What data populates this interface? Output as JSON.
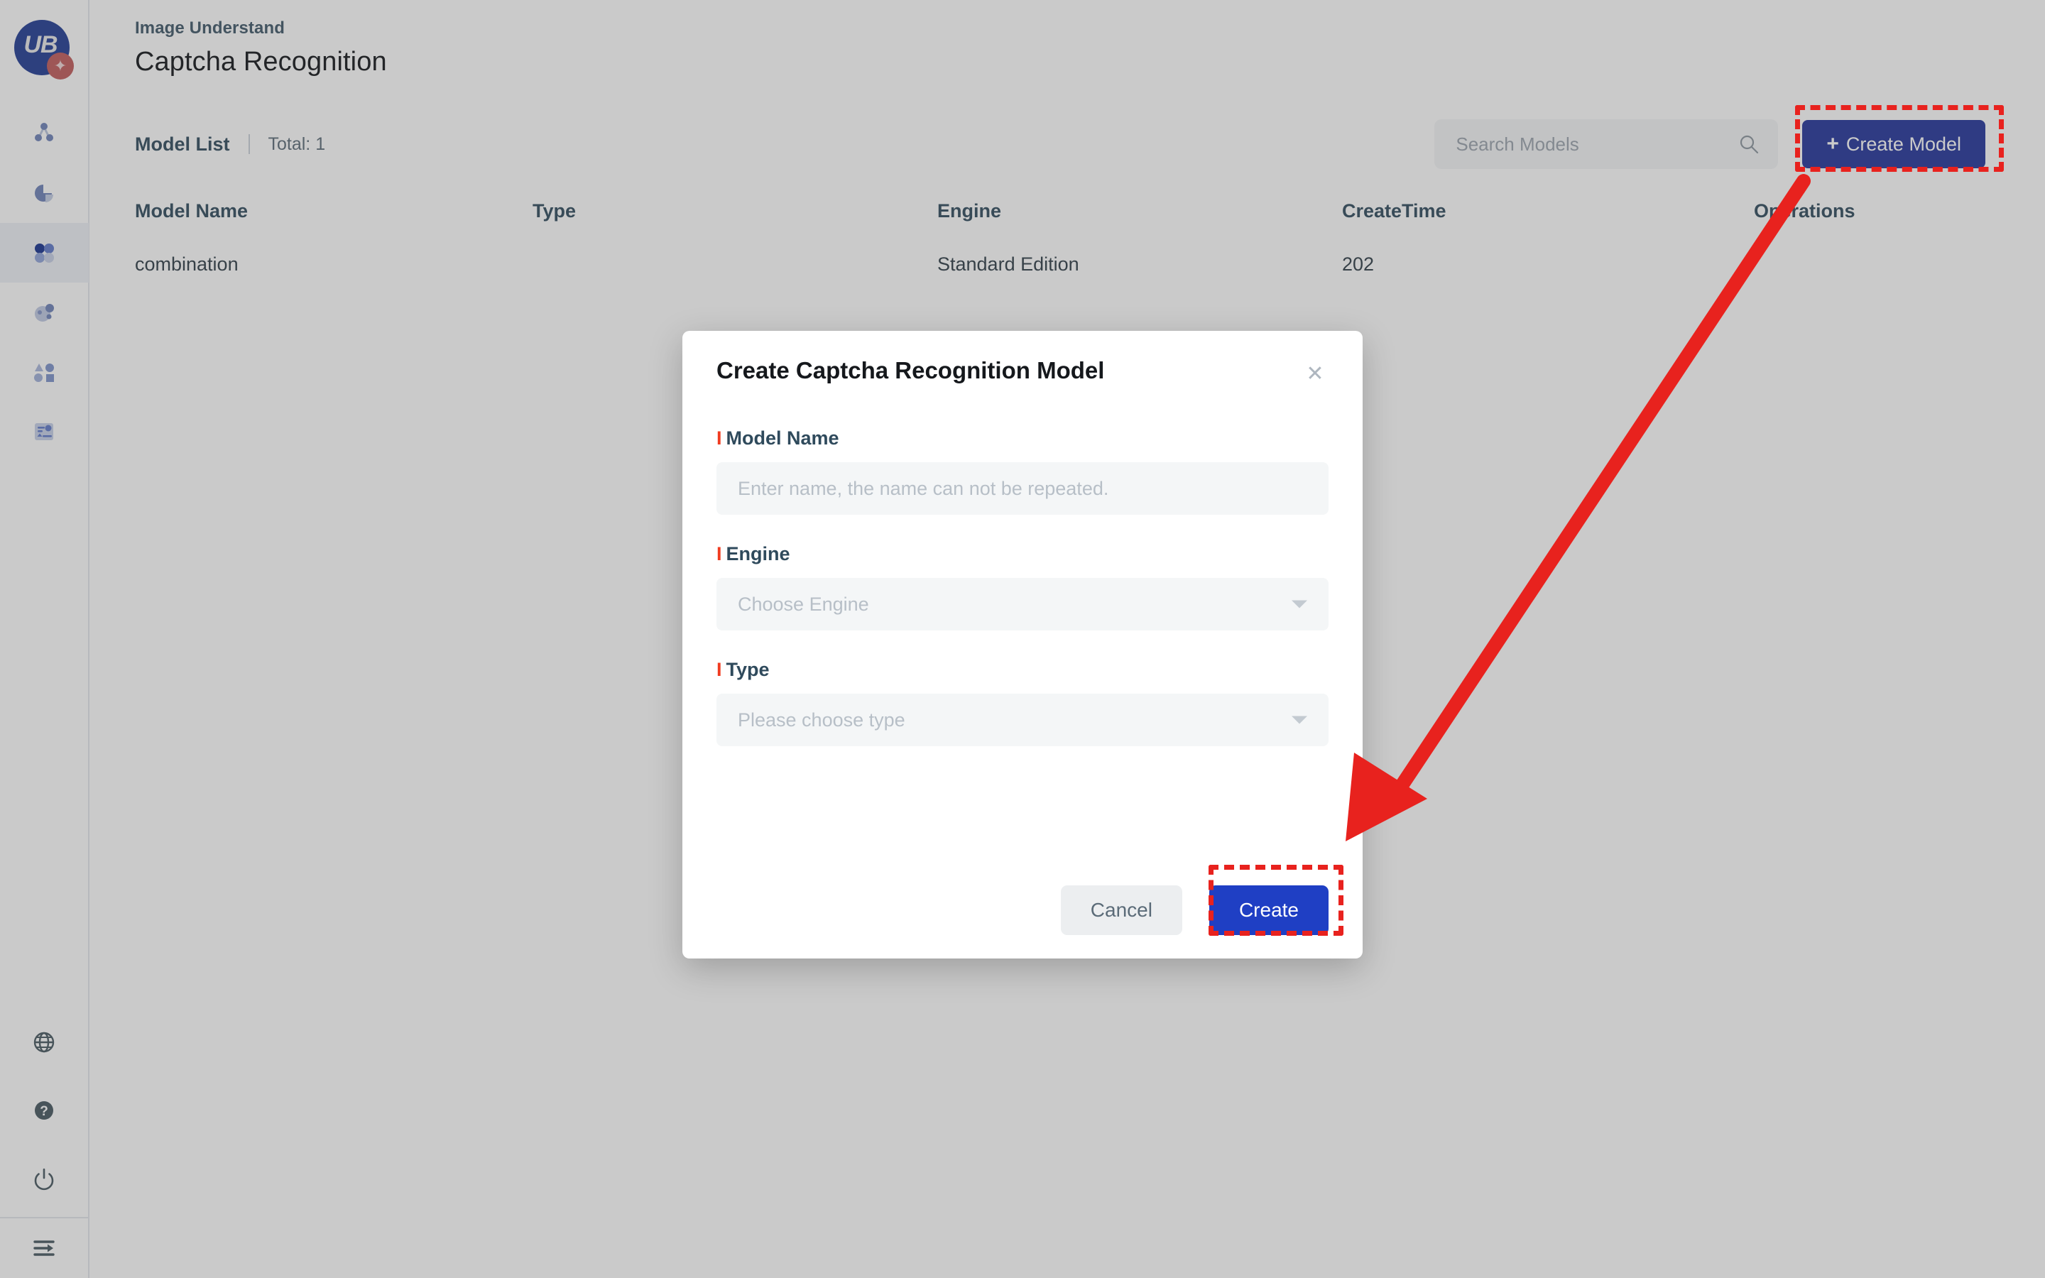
{
  "brand": {
    "logo_text": "UB",
    "logo_badge_icon": "spark-icon",
    "primary_color": "#22339a",
    "accent_red": "#e8221e"
  },
  "sidebar": {
    "items": [
      {
        "id": "nav-graph",
        "icon": "node-graph-icon",
        "active": false
      },
      {
        "id": "nav-analytics",
        "icon": "pie-chart-icon",
        "active": false
      },
      {
        "id": "nav-captcha",
        "icon": "four-dots-icon",
        "active": true
      },
      {
        "id": "nav-detection",
        "icon": "object-detect-icon",
        "active": false
      },
      {
        "id": "nav-shapes",
        "icon": "shapes-icon",
        "active": false
      },
      {
        "id": "nav-document",
        "icon": "id-card-icon",
        "active": false
      }
    ],
    "bottom_items": [
      {
        "id": "globe",
        "icon": "globe-icon"
      },
      {
        "id": "help",
        "icon": "help-circle-icon"
      },
      {
        "id": "power",
        "icon": "power-icon"
      }
    ],
    "collapse": {
      "id": "collapse",
      "icon": "collapse-sidebar-icon"
    }
  },
  "header": {
    "breadcrumb": "Image Understand",
    "title": "Captcha Recognition"
  },
  "toolbar": {
    "list_label": "Model List",
    "total_label": "Total: 1",
    "search": {
      "placeholder": "Search Models",
      "value": "",
      "icon": "search-icon"
    },
    "create_button": {
      "plus": "+",
      "label": "Create Model"
    }
  },
  "table": {
    "columns": [
      "Model Name",
      "Type",
      "Engine",
      "CreateTime",
      "Operations"
    ],
    "rows": [
      {
        "model_name": "combination",
        "type": "",
        "engine": "Standard Edition",
        "create_time": "202",
        "operations": ""
      }
    ]
  },
  "modal": {
    "title": "Create Captcha Recognition Model",
    "close_icon": "close-icon",
    "fields": [
      {
        "id": "model-name",
        "label": "Model Name",
        "required_mark": "I",
        "control": "input",
        "placeholder": "Enter name, the name can not be repeated.",
        "value": ""
      },
      {
        "id": "engine",
        "label": "Engine",
        "required_mark": "I",
        "control": "select",
        "placeholder": "Choose Engine",
        "value": "",
        "caret_icon": "chevron-down-icon"
      },
      {
        "id": "type",
        "label": "Type",
        "required_mark": "I",
        "control": "select",
        "placeholder": "Please choose type",
        "value": "",
        "caret_icon": "chevron-down-icon"
      }
    ],
    "cancel_label": "Cancel",
    "create_label": "Create"
  },
  "annotations": {
    "highlight_color": "#e8221e",
    "arrow": {
      "from": "create-model-button",
      "to": "modal-create-button"
    }
  }
}
